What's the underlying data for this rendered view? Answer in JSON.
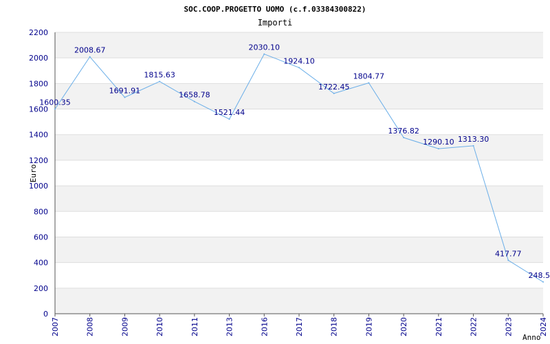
{
  "chart_data": {
    "type": "line",
    "title": "SOC.COOP.PROGETTO UOMO (c.f.03384300822)",
    "subtitle": "Importi",
    "ylabel": "Euro",
    "xlabel": "Anno",
    "ylim": [
      0,
      2200
    ],
    "yticks": [
      0,
      200,
      400,
      600,
      800,
      1000,
      1200,
      1400,
      1600,
      1800,
      2000,
      2200
    ],
    "grid": true,
    "x": [
      "2007",
      "2008",
      "2009",
      "2010",
      "2011",
      "2013",
      "2016",
      "2017",
      "2018",
      "2019",
      "2020",
      "2021",
      "2022",
      "2023",
      "2024"
    ],
    "values": [
      1600.35,
      2008.67,
      1691.91,
      1815.63,
      1658.78,
      1521.44,
      2030.1,
      1924.1,
      1722.45,
      1804.77,
      1376.82,
      1290.1,
      1313.3,
      417.77,
      248.5
    ],
    "labels": [
      "1600.35",
      "2008.67",
      "1691.91",
      "1815.63",
      "1658.78",
      "1521.44",
      "2030.10",
      "1924.10",
      "1722.45",
      "1804.77",
      "1376.82",
      "1290.10",
      "1313.30",
      "417.77",
      "248.5"
    ],
    "colors": {
      "line": "#6aaee8",
      "tick_text": "#00008b",
      "band": "#f2f2f2",
      "grid": "#dddddd"
    }
  }
}
